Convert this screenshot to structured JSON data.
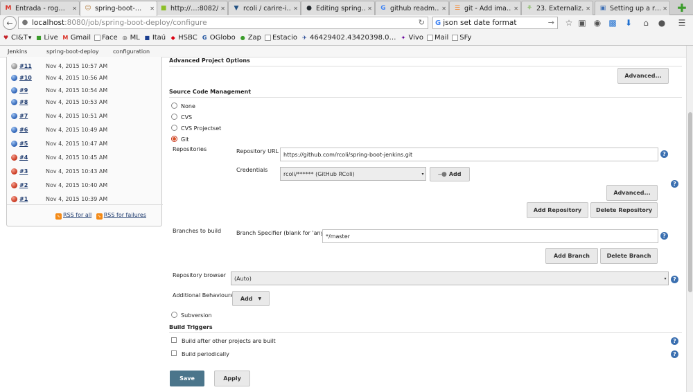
{
  "browser": {
    "tabs": [
      {
        "label": "Entrada - rog…",
        "icon": "M",
        "icon_color": "#d93025"
      },
      {
        "label": "spring-boot-…",
        "icon": "☺",
        "icon_color": "#b8864b",
        "active": true
      },
      {
        "label": "http://…:8082/",
        "icon": "■",
        "icon_color": "#8cbf26"
      },
      {
        "label": "rcoli / carire-i…",
        "icon": "▼",
        "icon_color": "#205081"
      },
      {
        "label": "Editing spring…",
        "icon": "●",
        "icon_color": "#24292e"
      },
      {
        "label": "github readm…",
        "icon": "G",
        "icon_color": "#4285f4"
      },
      {
        "label": "git - Add ima…",
        "icon": "☰",
        "icon_color": "#f48024"
      },
      {
        "label": "23. Externaliz…",
        "icon": "⚘",
        "icon_color": "#6db33f"
      },
      {
        "label": "Setting up a r…",
        "icon": "▣",
        "icon_color": "#3c6eb4"
      }
    ],
    "url_host": "localhost",
    "url_path": ":8080/job/spring-boot-deploy/configure",
    "search_text": "json set date format",
    "bookmarks": [
      {
        "label": "CI&T",
        "icon": "♥",
        "color": "#c42127",
        "dropdown": "▾"
      },
      {
        "label": "Live",
        "icon": "■",
        "color": "#3b9c2b"
      },
      {
        "label": "Gmail",
        "icon": "M",
        "color": "#d93025"
      },
      {
        "label": "Face",
        "icon": "",
        "color": "#999",
        "box": true
      },
      {
        "label": "ML",
        "icon": "◎",
        "color": "#333"
      },
      {
        "label": "Itaú",
        "icon": "■",
        "color": "#1a3d8f"
      },
      {
        "label": "HSBC",
        "icon": "◆",
        "color": "#db0011"
      },
      {
        "label": "OGlobo",
        "icon": "G",
        "color": "#1a4f9c"
      },
      {
        "label": "Zap",
        "icon": "●",
        "color": "#3b9c2b"
      },
      {
        "label": "Estacio",
        "icon": "",
        "color": "#999",
        "box": true
      },
      {
        "label": "46429402.43420398.0…",
        "icon": "✈",
        "color": "#1a3d8f"
      },
      {
        "label": "Vivo",
        "icon": "✦",
        "color": "#660099"
      },
      {
        "label": "Mail",
        "icon": "",
        "color": "#999",
        "box": true
      },
      {
        "label": "SFy",
        "icon": "",
        "color": "#999",
        "box": true
      }
    ]
  },
  "breadcrumbs": [
    "Jenkins",
    "spring-boot-deploy",
    "configuration"
  ],
  "builds": [
    {
      "num": "#11",
      "date": "Nov 4, 2015 10:57 AM",
      "status": "grey"
    },
    {
      "num": "#10",
      "date": "Nov 4, 2015 10:56 AM",
      "status": "blue"
    },
    {
      "num": "#9",
      "date": "Nov 4, 2015 10:54 AM",
      "status": "blue"
    },
    {
      "num": "#8",
      "date": "Nov 4, 2015 10:53 AM",
      "status": "blue"
    },
    {
      "num": "#7",
      "date": "Nov 4, 2015 10:51 AM",
      "status": "blue"
    },
    {
      "num": "#6",
      "date": "Nov 4, 2015 10:49 AM",
      "status": "blue"
    },
    {
      "num": "#5",
      "date": "Nov 4, 2015 10:47 AM",
      "status": "blue"
    },
    {
      "num": "#4",
      "date": "Nov 4, 2015 10:45 AM",
      "status": "red"
    },
    {
      "num": "#3",
      "date": "Nov 4, 2015 10:43 AM",
      "status": "red"
    },
    {
      "num": "#2",
      "date": "Nov 4, 2015 10:40 AM",
      "status": "red"
    },
    {
      "num": "#1",
      "date": "Nov 4, 2015 10:39 AM",
      "status": "red"
    }
  ],
  "rss": {
    "all": "RSS for all",
    "failures": "RSS for failures"
  },
  "config": {
    "advanced_project_options": "Advanced Project Options",
    "advanced_btn": "Advanced...",
    "scm_title": "Source Code Management",
    "scm_none": "None",
    "scm_cvs": "CVS",
    "scm_cvs_projectset": "CVS Projectset",
    "scm_git": "Git",
    "scm_subversion": "Subversion",
    "repositories_label": "Repositories",
    "repo_url_label": "Repository URL",
    "repo_url_value": "https://github.com/rcoli/spring-boot-jenkins.git",
    "credentials_label": "Credentials",
    "credentials_value": "rcoli/****** (GitHub RColi)",
    "add_btn": "Add",
    "repo_advanced_btn": "Advanced...",
    "add_repository_btn": "Add Repository",
    "delete_repository_btn": "Delete Repository",
    "branches_label": "Branches to build",
    "branch_specifier_label": "Branch Specifier (blank for 'any')",
    "branch_specifier_value": "*/master",
    "add_branch_btn": "Add Branch",
    "delete_branch_btn": "Delete Branch",
    "repo_browser_label": "Repository browser",
    "repo_browser_value": "(Auto)",
    "additional_behaviours_label": "Additional Behaviours",
    "additional_add_btn": "Add",
    "build_triggers_title": "Build Triggers",
    "trigger_after_other": "Build after other projects are built",
    "trigger_periodically": "Build periodically",
    "save_btn": "Save",
    "apply_btn": "Apply",
    "help_glyph": "?"
  },
  "colors": {
    "accent_button": "#4b758b",
    "status_blue": "#2a5fb3",
    "status_red": "#c7331a",
    "help_icon": "#3a6fb0"
  }
}
